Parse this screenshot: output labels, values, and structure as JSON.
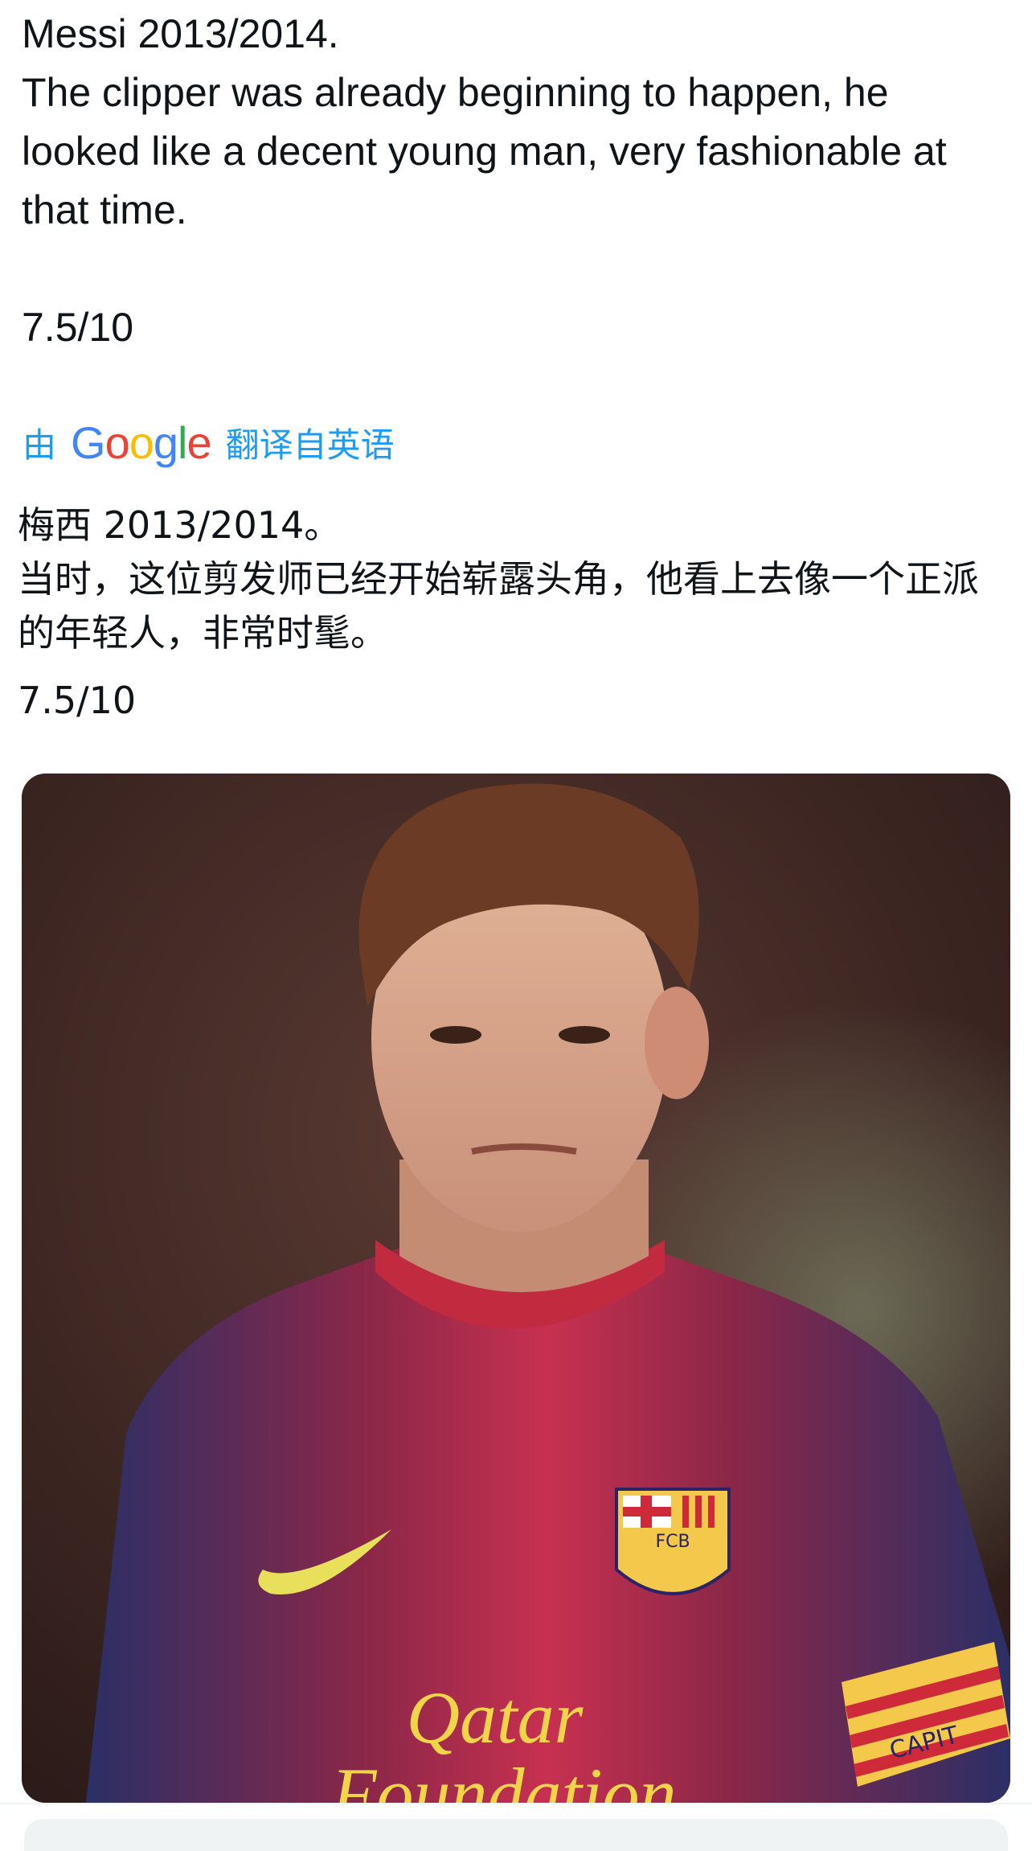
{
  "tweet": {
    "text": "Messi 2013/2014.\nThe clipper was already beginning to happen, he looked like a decent young man, very fashionable at that time.\n\n7.5/10"
  },
  "translation": {
    "by_label": "由",
    "provider": "Google",
    "from_label": "翻译自英语",
    "text": "梅西 2013/2014。\n当时，这位剪发师已经开始崭露头角，他看上去像一个正派的年轻人，非常时髦。",
    "rating": "7.5/10"
  },
  "media": {
    "shirt_sponsor": "Qatar\nFoundation",
    "crest_text": "FCB",
    "armband_text": "CAPIT"
  },
  "colors": {
    "link": "#1d9bf0",
    "text": "#0f1419",
    "google_blue": "#4285F4",
    "google_red": "#EA4335",
    "google_yellow": "#FBBC05",
    "google_green": "#34A853"
  }
}
